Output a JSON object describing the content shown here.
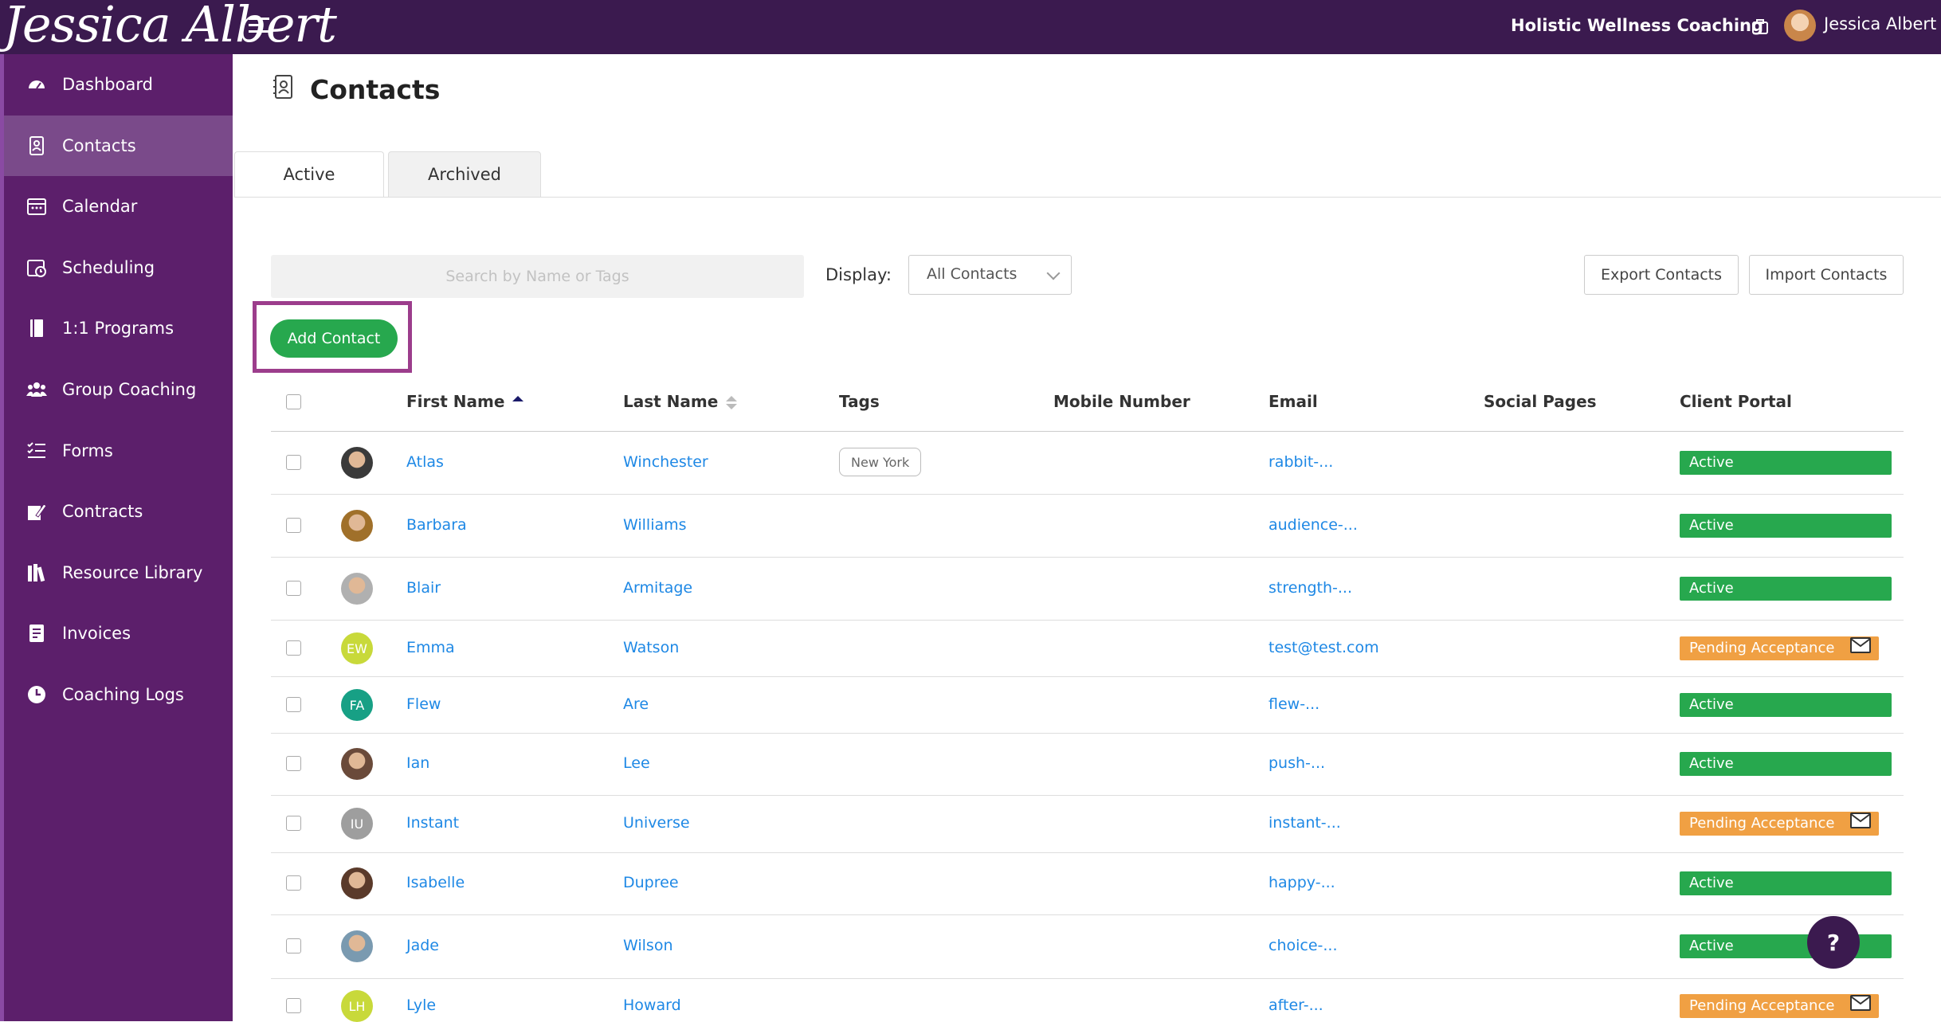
{
  "app": {
    "logo_text": "Jessica Albert",
    "business_name": "Holistic Wellness Coaching",
    "user_name": "Jessica Albert"
  },
  "sidebar": {
    "items": [
      {
        "label": "Dashboard",
        "icon": "dashboard-icon"
      },
      {
        "label": "Contacts",
        "icon": "contacts-icon",
        "active": true
      },
      {
        "label": "Calendar",
        "icon": "calendar-icon"
      },
      {
        "label": "Scheduling",
        "icon": "scheduling-icon"
      },
      {
        "label": "1:1 Programs",
        "icon": "book-icon"
      },
      {
        "label": "Group Coaching",
        "icon": "group-icon"
      },
      {
        "label": "Forms",
        "icon": "list-check-icon"
      },
      {
        "label": "Contracts",
        "icon": "signature-icon"
      },
      {
        "label": "Resource Library",
        "icon": "library-icon"
      },
      {
        "label": "Invoices",
        "icon": "invoice-icon"
      },
      {
        "label": "Coaching Logs",
        "icon": "clock-icon"
      }
    ]
  },
  "page": {
    "title": "Contacts",
    "tabs": [
      "Active",
      "Archived"
    ]
  },
  "toolbar": {
    "search_placeholder": "Search by Name or Tags",
    "display_label": "Display:",
    "display_value": "All Contacts",
    "export_label": "Export Contacts",
    "import_label": "Import Contacts",
    "add_label": "Add Contact"
  },
  "table": {
    "headers": [
      "First Name",
      "Last Name",
      "Tags",
      "Mobile Number",
      "Email",
      "Social Pages",
      "Client Portal"
    ],
    "rows": [
      {
        "first": "Atlas",
        "last": "Winchester",
        "tag": "New York",
        "email": "rabbit-...",
        "status": "Active",
        "avatar": "photo",
        "avatar_color": "#3a3a3a"
      },
      {
        "first": "Barbara",
        "last": "Williams",
        "tag": "",
        "email": "audience-...",
        "status": "Active",
        "avatar": "photo",
        "avatar_color": "#a0702a"
      },
      {
        "first": "Blair",
        "last": "Armitage",
        "tag": "",
        "email": "strength-...",
        "status": "Active",
        "avatar": "photo",
        "avatar_color": "#b0b0b0"
      },
      {
        "first": "Emma",
        "last": "Watson",
        "tag": "",
        "email": "test@test.com",
        "status": "Pending Acceptance",
        "avatar": "EW",
        "avatar_color": "#c8d93a"
      },
      {
        "first": "Flew",
        "last": "Are",
        "tag": "",
        "email": "flew-...",
        "status": "Active",
        "avatar": "FA",
        "avatar_color": "#17a085"
      },
      {
        "first": "Ian",
        "last": "Lee",
        "tag": "",
        "email": "push-...",
        "status": "Active",
        "avatar": "photo",
        "avatar_color": "#6a4a3a"
      },
      {
        "first": "Instant",
        "last": "Universe",
        "tag": "",
        "email": "instant-...",
        "status": "Pending Acceptance",
        "avatar": "IU",
        "avatar_color": "#9e9e9e"
      },
      {
        "first": "Isabelle",
        "last": "Dupree",
        "tag": "",
        "email": "happy-...",
        "status": "Active",
        "avatar": "photo",
        "avatar_color": "#5a3a2a"
      },
      {
        "first": "Jade",
        "last": "Wilson",
        "tag": "",
        "email": "choice-...",
        "status": "Active",
        "avatar": "photo",
        "avatar_color": "#7a9ab0"
      },
      {
        "first": "Lyle",
        "last": "Howard",
        "tag": "",
        "email": "after-...",
        "status": "Pending Acceptance",
        "avatar": "LH",
        "avatar_color": "#c8d93a"
      }
    ]
  },
  "colors": {
    "topbar": "#3b1a4f",
    "sidebar": "#5c1f6b",
    "active_status": "#27a84e",
    "pending_status": "#f0a043",
    "link": "#1e88e5"
  },
  "help_label": "?"
}
